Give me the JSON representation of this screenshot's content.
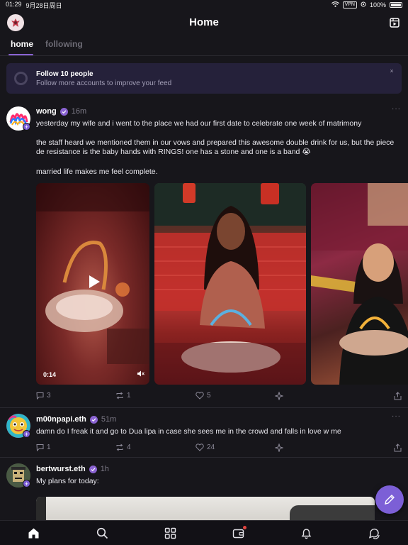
{
  "status_bar": {
    "time": "01:29",
    "date": "9月28日周日",
    "vpn": "VPN",
    "battery": "100%",
    "battery_level": 1.0
  },
  "header": {
    "title": "Home"
  },
  "tabs": [
    {
      "label": "home",
      "active": true
    },
    {
      "label": "following",
      "active": false
    }
  ],
  "onboarding": {
    "title": "Follow 10 people",
    "subtitle": "Follow more accounts to improve your feed",
    "close": "×"
  },
  "casts": [
    {
      "author": "wong",
      "time": "16m",
      "text_lines": [
        "yesterday my wife and i went to the place we had our first date to celebrate one week of matrimony",
        "the staff heard we mentioned them in our vows and prepared this awesome double drink for us, but the piece de resistance is the baby hands with RINGS! one has a stone and one is a band 😭",
        "married life makes me feel complete."
      ],
      "video_time": "0:14",
      "replies": "3",
      "recasts": "1",
      "likes": "5"
    },
    {
      "author": "m00npapi.eth",
      "time": "51m",
      "text": "damn do I freak it and go to Dua lipa in case she sees me in the crowd and falls in love w me",
      "replies": "1",
      "recasts": "4",
      "likes": "24"
    },
    {
      "author": "bertwurst.eth",
      "time": "1h",
      "text": "My plans for today:"
    }
  ],
  "colors": {
    "background": "#17161b",
    "accent": "#8a63d2",
    "card": "#25213a",
    "muted": "#8c8998",
    "notification_dot": "#e2453f"
  },
  "icons": {
    "header_right": "frames-icon",
    "nav": [
      "home-icon",
      "search-icon",
      "explore-grid-icon",
      "wallet-icon",
      "bell-icon",
      "messages-icon"
    ],
    "cast_actions": [
      "reply-icon",
      "recast-icon",
      "heart-icon",
      "tip-icon",
      "share-icon"
    ]
  }
}
